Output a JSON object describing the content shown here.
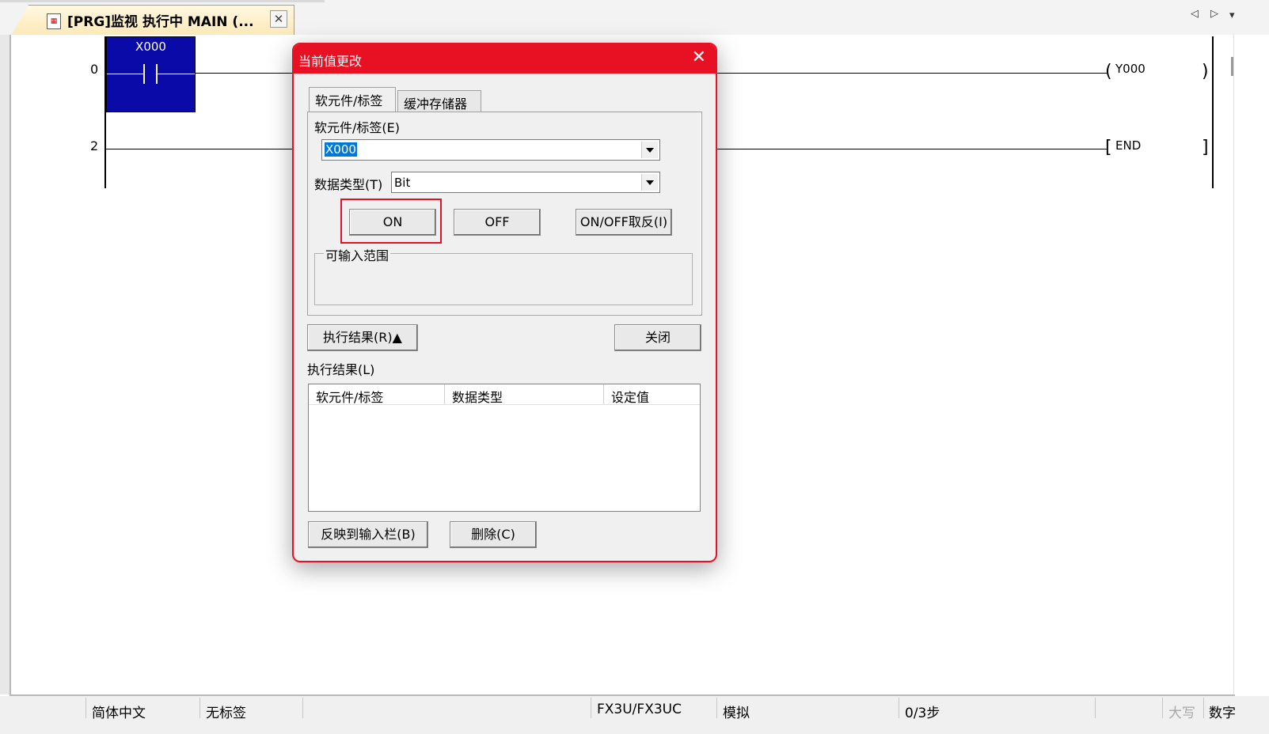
{
  "tab": {
    "title": "[PRG]监视 执行中 MAIN (...",
    "close": "✕"
  },
  "ladder": {
    "rung0_step": "0",
    "rung1_step": "2",
    "contact_label": "X000",
    "coil_label": "Y000",
    "end_label": "END"
  },
  "dialog": {
    "title": "当前值更改",
    "tabs": [
      "软元件/标签",
      "缓冲存储器"
    ],
    "device_label": "软元件/标签(E)",
    "device_value": "X000",
    "datatype_label": "数据类型(T)",
    "datatype_value": "Bit",
    "btn_on": "ON",
    "btn_off": "OFF",
    "btn_toggle": "ON/OFF取反(I)",
    "range_group": "可输入范围",
    "btn_results": "执行结果(R)▲",
    "btn_close": "关闭",
    "results_label": "执行结果(L)",
    "results_columns": [
      "软元件/标签",
      "数据类型",
      "设定值"
    ],
    "btn_reflect": "反映到输入栏(B)",
    "btn_delete": "删除(C)"
  },
  "status": {
    "language": "简体中文",
    "label": "无标签",
    "plc": "FX3U/FX3UC",
    "mode": "模拟",
    "steps": "0/3步",
    "caps": "大写",
    "num": "数字"
  },
  "colors": {
    "accent": "#e81123",
    "contact_bg": "#0a0aa8"
  }
}
